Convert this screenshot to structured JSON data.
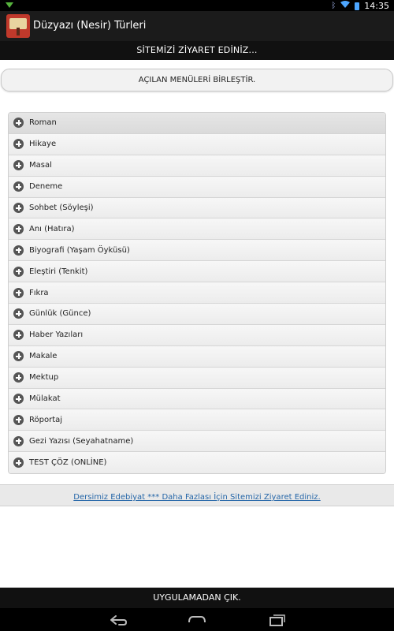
{
  "status_bar": {
    "time": "14:35"
  },
  "action_bar": {
    "title": "Düzyazı (Nesir) Türleri"
  },
  "banner": {
    "label": "SİTEMİZİ ZİYARET EDİNİZ..."
  },
  "merge_button": {
    "label": "AÇILAN MENÜLERİ BİRLEŞTİR."
  },
  "menu": {
    "items": [
      {
        "label": "Roman"
      },
      {
        "label": "Hikaye"
      },
      {
        "label": "Masal"
      },
      {
        "label": "Deneme"
      },
      {
        "label": "Sohbet (Söyleşi)"
      },
      {
        "label": "Anı (Hatıra)"
      },
      {
        "label": "Biyografi (Yaşam Öyküsü)"
      },
      {
        "label": "Eleştiri (Tenkit)"
      },
      {
        "label": "Fıkra"
      },
      {
        "label": "Günlük (Günce)"
      },
      {
        "label": "Haber Yazıları"
      },
      {
        "label": "Makale"
      },
      {
        "label": "Mektup"
      },
      {
        "label": "Mülakat"
      },
      {
        "label": "Röportaj"
      },
      {
        "label": "Gezi Yazısı (Seyahatname)"
      },
      {
        "label": "TEST ÇÖZ (ONLİNE)"
      }
    ]
  },
  "footer_link": {
    "label": "Dersimiz Edebiyat *** Daha Fazlası İçin Sitemizi Ziyaret Ediniz."
  },
  "exit_bar": {
    "label": "UYGULAMADAN ÇIK."
  },
  "icons": {
    "notification": "download-notification-icon",
    "bluetooth": "bluetooth-icon",
    "wifi": "wifi-icon",
    "battery": "battery-icon",
    "app_logo": "app-logo-icon",
    "menu_item": "plus-circle-icon",
    "back": "back-icon",
    "home": "home-icon",
    "recents": "recents-icon"
  },
  "colors": {
    "status_bar": "#000000",
    "action_bar": "#1b1b1b",
    "banner": "#111111",
    "link": "#2566a8",
    "menu_item_bg": "#f2f2f2"
  }
}
